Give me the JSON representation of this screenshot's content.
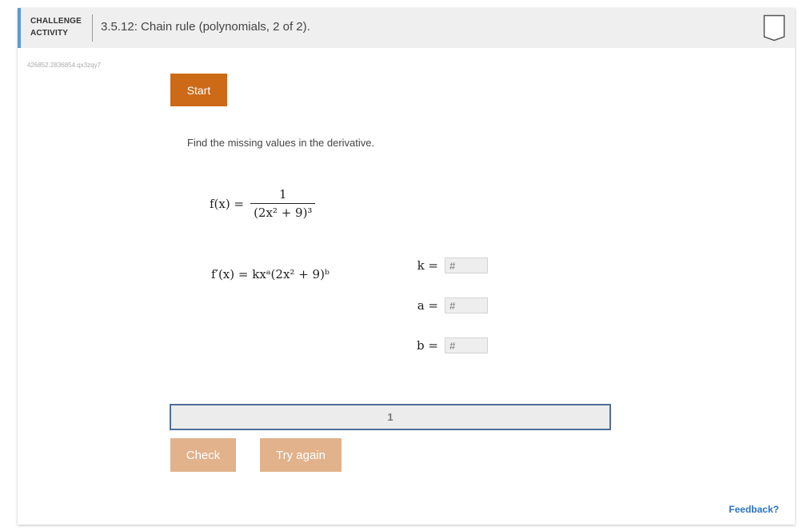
{
  "header": {
    "activity_type_line1": "CHALLENGE",
    "activity_type_line2": "ACTIVITY",
    "title": "3.5.12: Chain rule (polynomials, 2 of 2).",
    "bookmark_icon": "bookmark-icon"
  },
  "activity_id": "426852.2836854.qx3zqy7",
  "start_label": "Start",
  "instruction": "Find the missing values in the derivative.",
  "function": {
    "lhs": "f(x) =",
    "numerator": "1",
    "denominator": "(2x² + 9)³"
  },
  "derivative": {
    "expression": "f′(x) = kxᵃ(2x² + 9)ᵇ"
  },
  "variables": [
    {
      "label": "k =",
      "placeholder": "#"
    },
    {
      "label": "a =",
      "placeholder": "#"
    },
    {
      "label": "b =",
      "placeholder": "#"
    }
  ],
  "progress": {
    "current_step": "1"
  },
  "buttons": {
    "check": "Check",
    "try_again": "Try again"
  },
  "feedback_link": "Feedback?",
  "colors": {
    "accent_blue": "#5a9bd5",
    "start_button": "#cc6a18",
    "disabled_button": "#e1b28b",
    "progress_border": "#4e6e96",
    "link": "#2a73c4"
  }
}
